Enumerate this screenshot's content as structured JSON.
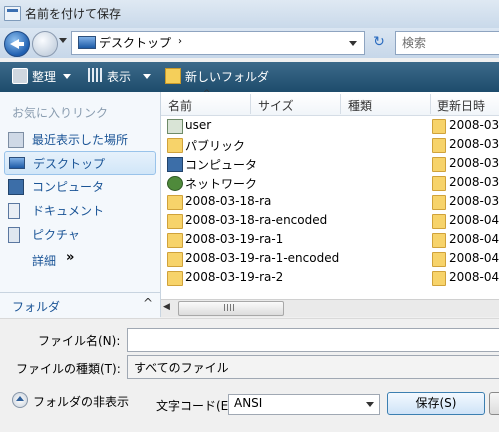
{
  "window": {
    "title": "名前を付けて保存"
  },
  "address": {
    "path": "デスクトップ",
    "separator": "›",
    "search_placeholder": "検索"
  },
  "toolbar": {
    "organize": "整理",
    "views": "表示",
    "new_folder": "新しいフォルダ"
  },
  "sidebar": {
    "header": "お気に入りリンク",
    "items": [
      {
        "label": "最近表示した場所",
        "icon": "recent-places-icon"
      },
      {
        "label": "デスクトップ",
        "icon": "desktop-icon",
        "selected": true
      },
      {
        "label": "コンピュータ",
        "icon": "computer-icon"
      },
      {
        "label": "ドキュメント",
        "icon": "documents-icon"
      },
      {
        "label": "ピクチャ",
        "icon": "pictures-icon"
      }
    ],
    "more": "詳細",
    "more_arrow": "»",
    "folders_label": "フォルダ",
    "folders_chevron": "^"
  },
  "file_list": {
    "columns": [
      "名前",
      "サイズ",
      "種類",
      "更新日時"
    ],
    "sort_arrow": "^",
    "names": [
      {
        "name": "user",
        "icon": "user-folder-icon"
      },
      {
        "name": "パブリック",
        "icon": "folder-icon"
      },
      {
        "name": "コンピュータ",
        "icon": "computer-icon"
      },
      {
        "name": "ネットワーク",
        "icon": "network-icon"
      },
      {
        "name": "2008-03-18-ra",
        "icon": "folder-icon"
      },
      {
        "name": "2008-03-18-ra-encoded",
        "icon": "folder-icon"
      },
      {
        "name": "2008-03-19-ra-1",
        "icon": "folder-icon"
      },
      {
        "name": "2008-03-19-ra-1-encoded",
        "icon": "folder-icon"
      },
      {
        "name": "2008-03-19-ra-2",
        "icon": "folder-icon"
      }
    ],
    "dates": [
      "2008-03-",
      "2008-03-",
      "2008-03-",
      "2008-03-",
      "2008-03-",
      "2008-04-",
      "2008-04-",
      "2008-04-",
      "2008-04-"
    ]
  },
  "form": {
    "filename_label": "ファイル名(N):",
    "filename_value": "",
    "filetype_label": "ファイルの種類(T):",
    "filetype_value": "すべてのファイル",
    "hide_folders": "フォルダの非表示",
    "encoding_label": "文字コード(E):",
    "encoding_value": "ANSI",
    "save": "保存(S)"
  },
  "colors": {
    "toolbar": "#2b5878",
    "link": "#1a5496",
    "folder": "#f7d36a"
  }
}
